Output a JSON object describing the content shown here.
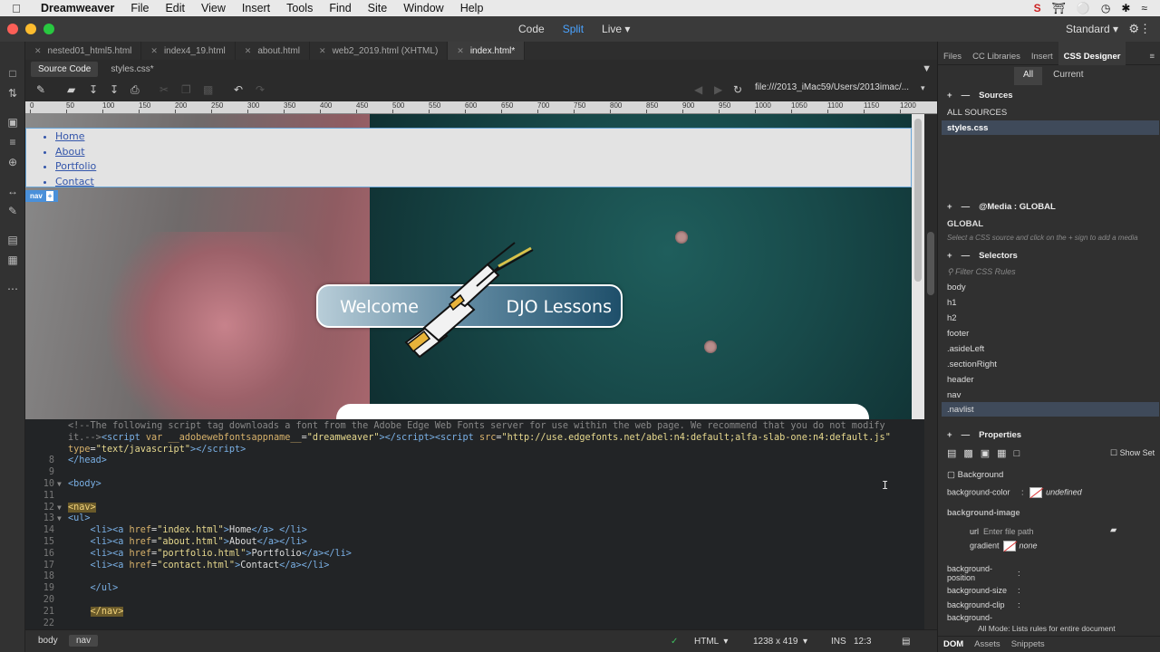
{
  "menubar": {
    "app": "Dreamweaver",
    "items": [
      "File",
      "Edit",
      "View",
      "Insert",
      "Tools",
      "Find",
      "Site",
      "Window",
      "Help"
    ],
    "right_icons": [
      "s-icon",
      "shield-icon",
      "cc-icon",
      "history-icon",
      "bluetooth-icon",
      "wifi-icon"
    ]
  },
  "titlebar": {
    "views": [
      "Code",
      "Split",
      "Live"
    ],
    "active_view": "Split",
    "workspace": "Standard"
  },
  "doc_tabs": [
    {
      "label": "nested01_html5.html",
      "active": false
    },
    {
      "label": "index4_19.html",
      "active": false
    },
    {
      "label": "about.html",
      "active": false
    },
    {
      "label": "web2_2019.html (XHTML)",
      "active": false
    },
    {
      "label": "index.html*",
      "active": true
    }
  ],
  "file_sub": {
    "source": "Source Code",
    "css": "styles.css*"
  },
  "url": "file:///2013_iMac59/Users/2013imac/...",
  "ruler_ticks": [
    "0",
    "50",
    "100",
    "150",
    "200",
    "250",
    "300",
    "350",
    "400",
    "450",
    "500",
    "550",
    "600",
    "650",
    "700",
    "750",
    "800",
    "850",
    "900",
    "950",
    "1000",
    "1050",
    "1100",
    "1150",
    "1200"
  ],
  "live": {
    "nav_links": [
      "Home",
      "About",
      "Portfolio",
      "Contact"
    ],
    "nav_tag": "nav",
    "banner_left": "Welcome",
    "banner_right": "DJO Lessons"
  },
  "code": {
    "lines": [
      {
        "n": "",
        "fold": "",
        "html": "<span class=\"cmt\">&lt;!--The following script tag downloads a font from the Adobe Edge Web Fonts server for use within the web page. We recommend that you do not modify</span>"
      },
      {
        "n": "",
        "fold": "",
        "html": "<span class=\"cmt\">it.--&gt;</span><span class=\"tag\">&lt;script</span> <span class=\"attr\">var</span> <span class=\"attr\">__adobewebfontsappname__</span>=<span class=\"str\">\"dreamweaver\"</span><span class=\"tag\">&gt;&lt;/script&gt;&lt;script</span> <span class=\"attr\">src</span>=<span class=\"str\">\"http://use.edgefonts.net/abel:n4:default;alfa-slab-one:n4:default.js\"</span>"
      },
      {
        "n": "",
        "fold": "",
        "html": "<span class=\"attr\">type</span>=<span class=\"str\">\"text/javascript\"</span><span class=\"tag\">&gt;&lt;/script&gt;</span>"
      },
      {
        "n": "8",
        "fold": "",
        "html": "<span class=\"tag\">&lt;/head&gt;</span>"
      },
      {
        "n": "9",
        "fold": "",
        "html": ""
      },
      {
        "n": "10",
        "fold": "▼",
        "html": "<span class=\"tag\">&lt;body&gt;</span>"
      },
      {
        "n": "11",
        "fold": "",
        "html": ""
      },
      {
        "n": "12",
        "fold": "▼",
        "html": "<span class=\"hl\">&lt;nav&gt;</span>"
      },
      {
        "n": "13",
        "fold": "▼",
        "html": "<span class=\"tag\">&lt;ul&gt;</span>"
      },
      {
        "n": "14",
        "fold": "",
        "html": "    <span class=\"tag\">&lt;li&gt;&lt;a</span> <span class=\"attr\">href</span>=<span class=\"str\">\"index.html\"</span><span class=\"tag\">&gt;</span>Home<span class=\"tag\">&lt;/a&gt;</span> <span class=\"tag\">&lt;/li&gt;</span>"
      },
      {
        "n": "15",
        "fold": "",
        "html": "    <span class=\"tag\">&lt;li&gt;&lt;a</span> <span class=\"attr\">href</span>=<span class=\"str\">\"about.html\"</span><span class=\"tag\">&gt;</span>About<span class=\"tag\">&lt;/a&gt;&lt;/li&gt;</span>"
      },
      {
        "n": "16",
        "fold": "",
        "html": "    <span class=\"tag\">&lt;li&gt;&lt;a</span> <span class=\"attr\">href</span>=<span class=\"str\">\"portfolio.html\"</span><span class=\"tag\">&gt;</span>Portfolio<span class=\"tag\">&lt;/a&gt;&lt;/li&gt;</span>"
      },
      {
        "n": "17",
        "fold": "",
        "html": "    <span class=\"tag\">&lt;li&gt;&lt;a</span> <span class=\"attr\">href</span>=<span class=\"str\">\"contact.html\"</span><span class=\"tag\">&gt;</span>Contact<span class=\"tag\">&lt;/a&gt;&lt;/li&gt;</span>"
      },
      {
        "n": "18",
        "fold": "",
        "html": ""
      },
      {
        "n": "19",
        "fold": "",
        "html": "    <span class=\"tag\">&lt;/ul&gt;</span>"
      },
      {
        "n": "20",
        "fold": "",
        "html": ""
      },
      {
        "n": "21",
        "fold": "",
        "html": "    <span class=\"hl\">&lt;/nav&gt;</span>"
      },
      {
        "n": "22",
        "fold": "",
        "html": ""
      }
    ]
  },
  "status": {
    "crumbs": [
      "body",
      "nav"
    ],
    "active_crumb": "nav",
    "language": "HTML",
    "size": "1238 x 419",
    "mode": "INS",
    "position": "12:3"
  },
  "panel": {
    "tabs": [
      "Files",
      "CC Libraries",
      "Insert",
      "CSS Designer"
    ],
    "active_tab": "CSS Designer",
    "seg": [
      "All",
      "Current"
    ],
    "sources_title": "Sources",
    "sources": [
      "ALL SOURCES",
      "styles.css"
    ],
    "media_title": "@Media : GLOBAL",
    "media_global": "GLOBAL",
    "media_hint": "Select a CSS source and click on the + sign to add a media",
    "selectors_title": "Selectors",
    "filter_placeholder": "Filter CSS Rules",
    "selectors": [
      "body",
      "h1",
      "h2",
      "footer",
      ".asideLeft",
      ".sectionRight",
      "header",
      "nav",
      ".navlist"
    ],
    "properties_title": "Properties",
    "show_set": "Show Set",
    "background_label": "Background",
    "bg_color_label": "background-color",
    "bg_color_value": "undefined",
    "bg_image_label": "background-image",
    "url_label": "url",
    "url_placeholder": "Enter file path",
    "gradient_label": "gradient",
    "gradient_value": "none",
    "bg_position_label": "background-position",
    "bg_size_label": "background-size",
    "bg_clip_label": "background-clip",
    "bg_repeat_label": "background-",
    "mode_hint": "All Mode: Lists rules for entire document",
    "bottom_tabs": [
      "DOM",
      "Assets",
      "Snippets"
    ],
    "active_bottom": "DOM"
  }
}
